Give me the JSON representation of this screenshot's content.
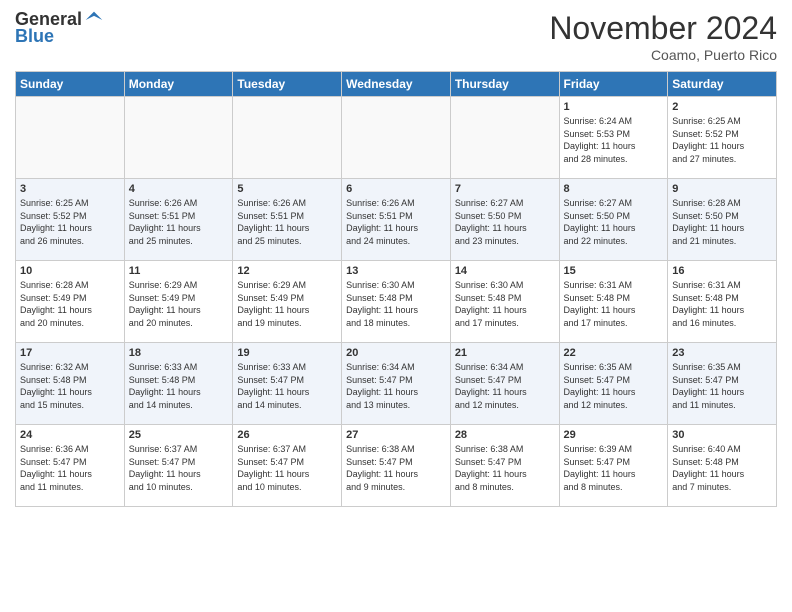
{
  "logo": {
    "line1": "General",
    "line2": "Blue"
  },
  "title": "November 2024",
  "subtitle": "Coamo, Puerto Rico",
  "headers": [
    "Sunday",
    "Monday",
    "Tuesday",
    "Wednesday",
    "Thursday",
    "Friday",
    "Saturday"
  ],
  "weeks": [
    [
      {
        "day": "",
        "info": ""
      },
      {
        "day": "",
        "info": ""
      },
      {
        "day": "",
        "info": ""
      },
      {
        "day": "",
        "info": ""
      },
      {
        "day": "",
        "info": ""
      },
      {
        "day": "1",
        "info": "Sunrise: 6:24 AM\nSunset: 5:53 PM\nDaylight: 11 hours\nand 28 minutes."
      },
      {
        "day": "2",
        "info": "Sunrise: 6:25 AM\nSunset: 5:52 PM\nDaylight: 11 hours\nand 27 minutes."
      }
    ],
    [
      {
        "day": "3",
        "info": "Sunrise: 6:25 AM\nSunset: 5:52 PM\nDaylight: 11 hours\nand 26 minutes."
      },
      {
        "day": "4",
        "info": "Sunrise: 6:26 AM\nSunset: 5:51 PM\nDaylight: 11 hours\nand 25 minutes."
      },
      {
        "day": "5",
        "info": "Sunrise: 6:26 AM\nSunset: 5:51 PM\nDaylight: 11 hours\nand 25 minutes."
      },
      {
        "day": "6",
        "info": "Sunrise: 6:26 AM\nSunset: 5:51 PM\nDaylight: 11 hours\nand 24 minutes."
      },
      {
        "day": "7",
        "info": "Sunrise: 6:27 AM\nSunset: 5:50 PM\nDaylight: 11 hours\nand 23 minutes."
      },
      {
        "day": "8",
        "info": "Sunrise: 6:27 AM\nSunset: 5:50 PM\nDaylight: 11 hours\nand 22 minutes."
      },
      {
        "day": "9",
        "info": "Sunrise: 6:28 AM\nSunset: 5:50 PM\nDaylight: 11 hours\nand 21 minutes."
      }
    ],
    [
      {
        "day": "10",
        "info": "Sunrise: 6:28 AM\nSunset: 5:49 PM\nDaylight: 11 hours\nand 20 minutes."
      },
      {
        "day": "11",
        "info": "Sunrise: 6:29 AM\nSunset: 5:49 PM\nDaylight: 11 hours\nand 20 minutes."
      },
      {
        "day": "12",
        "info": "Sunrise: 6:29 AM\nSunset: 5:49 PM\nDaylight: 11 hours\nand 19 minutes."
      },
      {
        "day": "13",
        "info": "Sunrise: 6:30 AM\nSunset: 5:48 PM\nDaylight: 11 hours\nand 18 minutes."
      },
      {
        "day": "14",
        "info": "Sunrise: 6:30 AM\nSunset: 5:48 PM\nDaylight: 11 hours\nand 17 minutes."
      },
      {
        "day": "15",
        "info": "Sunrise: 6:31 AM\nSunset: 5:48 PM\nDaylight: 11 hours\nand 17 minutes."
      },
      {
        "day": "16",
        "info": "Sunrise: 6:31 AM\nSunset: 5:48 PM\nDaylight: 11 hours\nand 16 minutes."
      }
    ],
    [
      {
        "day": "17",
        "info": "Sunrise: 6:32 AM\nSunset: 5:48 PM\nDaylight: 11 hours\nand 15 minutes."
      },
      {
        "day": "18",
        "info": "Sunrise: 6:33 AM\nSunset: 5:48 PM\nDaylight: 11 hours\nand 14 minutes."
      },
      {
        "day": "19",
        "info": "Sunrise: 6:33 AM\nSunset: 5:47 PM\nDaylight: 11 hours\nand 14 minutes."
      },
      {
        "day": "20",
        "info": "Sunrise: 6:34 AM\nSunset: 5:47 PM\nDaylight: 11 hours\nand 13 minutes."
      },
      {
        "day": "21",
        "info": "Sunrise: 6:34 AM\nSunset: 5:47 PM\nDaylight: 11 hours\nand 12 minutes."
      },
      {
        "day": "22",
        "info": "Sunrise: 6:35 AM\nSunset: 5:47 PM\nDaylight: 11 hours\nand 12 minutes."
      },
      {
        "day": "23",
        "info": "Sunrise: 6:35 AM\nSunset: 5:47 PM\nDaylight: 11 hours\nand 11 minutes."
      }
    ],
    [
      {
        "day": "24",
        "info": "Sunrise: 6:36 AM\nSunset: 5:47 PM\nDaylight: 11 hours\nand 11 minutes."
      },
      {
        "day": "25",
        "info": "Sunrise: 6:37 AM\nSunset: 5:47 PM\nDaylight: 11 hours\nand 10 minutes."
      },
      {
        "day": "26",
        "info": "Sunrise: 6:37 AM\nSunset: 5:47 PM\nDaylight: 11 hours\nand 10 minutes."
      },
      {
        "day": "27",
        "info": "Sunrise: 6:38 AM\nSunset: 5:47 PM\nDaylight: 11 hours\nand 9 minutes."
      },
      {
        "day": "28",
        "info": "Sunrise: 6:38 AM\nSunset: 5:47 PM\nDaylight: 11 hours\nand 8 minutes."
      },
      {
        "day": "29",
        "info": "Sunrise: 6:39 AM\nSunset: 5:47 PM\nDaylight: 11 hours\nand 8 minutes."
      },
      {
        "day": "30",
        "info": "Sunrise: 6:40 AM\nSunset: 5:48 PM\nDaylight: 11 hours\nand 7 minutes."
      }
    ]
  ]
}
